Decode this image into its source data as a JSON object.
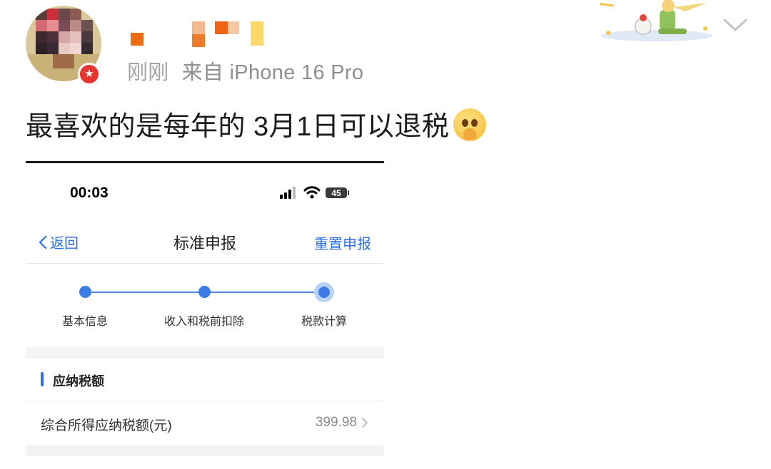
{
  "post": {
    "time": "刚刚",
    "source": "来自 iPhone 16 Pro",
    "text": "最喜欢的是每年的 3月1日可以退税",
    "icons": {
      "avatar": "avatar-pixelated",
      "badge": "star-badge-icon",
      "sticker": "little-prince-sticker",
      "more": "chevron-down-icon",
      "emoji": "pleading-face-emoji"
    }
  },
  "phone": {
    "status": {
      "time": "00:03",
      "battery": "45"
    },
    "nav": {
      "back": "返回",
      "title": "标准申报",
      "action": "重置申报"
    },
    "steps": [
      {
        "label": "基本信息"
      },
      {
        "label": "收入和税前扣除"
      },
      {
        "label": "税款计算",
        "current": true
      }
    ],
    "section": {
      "title": "应纳税额",
      "row": {
        "label": "综合所得应纳税额(元)",
        "value": "399.98"
      }
    }
  },
  "colors": {
    "accent": "#2f6fe4",
    "badge": "#e6342f",
    "muted": "#8e8e93"
  }
}
